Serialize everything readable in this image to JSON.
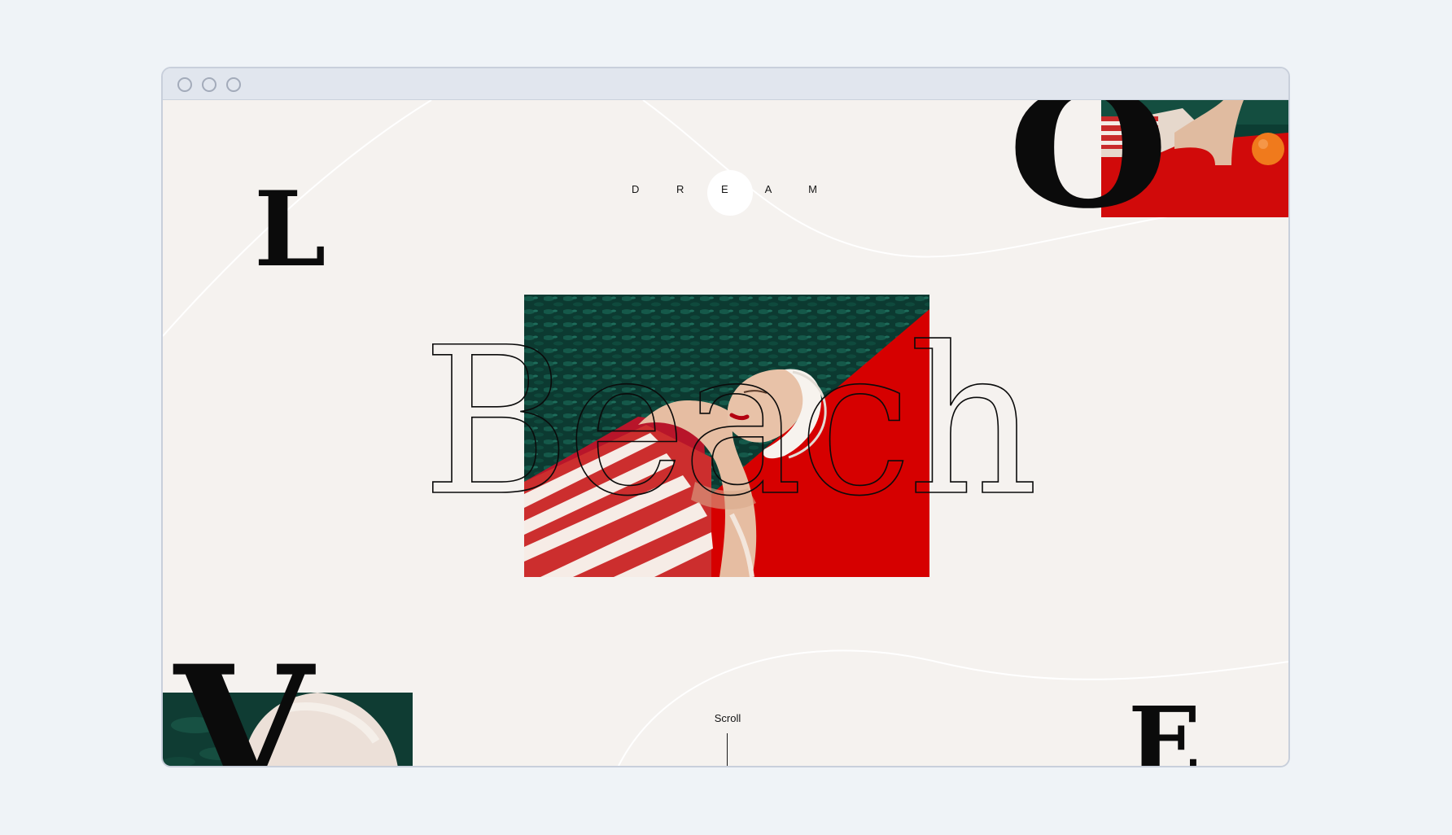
{
  "page": {
    "background": "#eff3f7",
    "window_bg": "#f5f2ef",
    "accent_red": "#d60000",
    "pool_green": "#0d4a3d",
    "text_dark": "#0b0b0b"
  },
  "window": {
    "controls": [
      "close-icon",
      "minimize-icon",
      "maximize-icon"
    ]
  },
  "hero": {
    "eyebrow": "D R E A M",
    "headline": "Beach"
  },
  "letters": {
    "top_left": "L",
    "top_right": "O",
    "bottom_left": "V",
    "bottom_right": "E"
  },
  "scroll": {
    "label": "Scroll"
  },
  "images": {
    "hero": "woman-in-striped-swimsuit-lying-on-red-mat-by-pool",
    "top_right": "woman-in-striped-swimsuit-with-orange-on-red-mat",
    "bottom_left": "white-swim-cap-by-pool"
  }
}
